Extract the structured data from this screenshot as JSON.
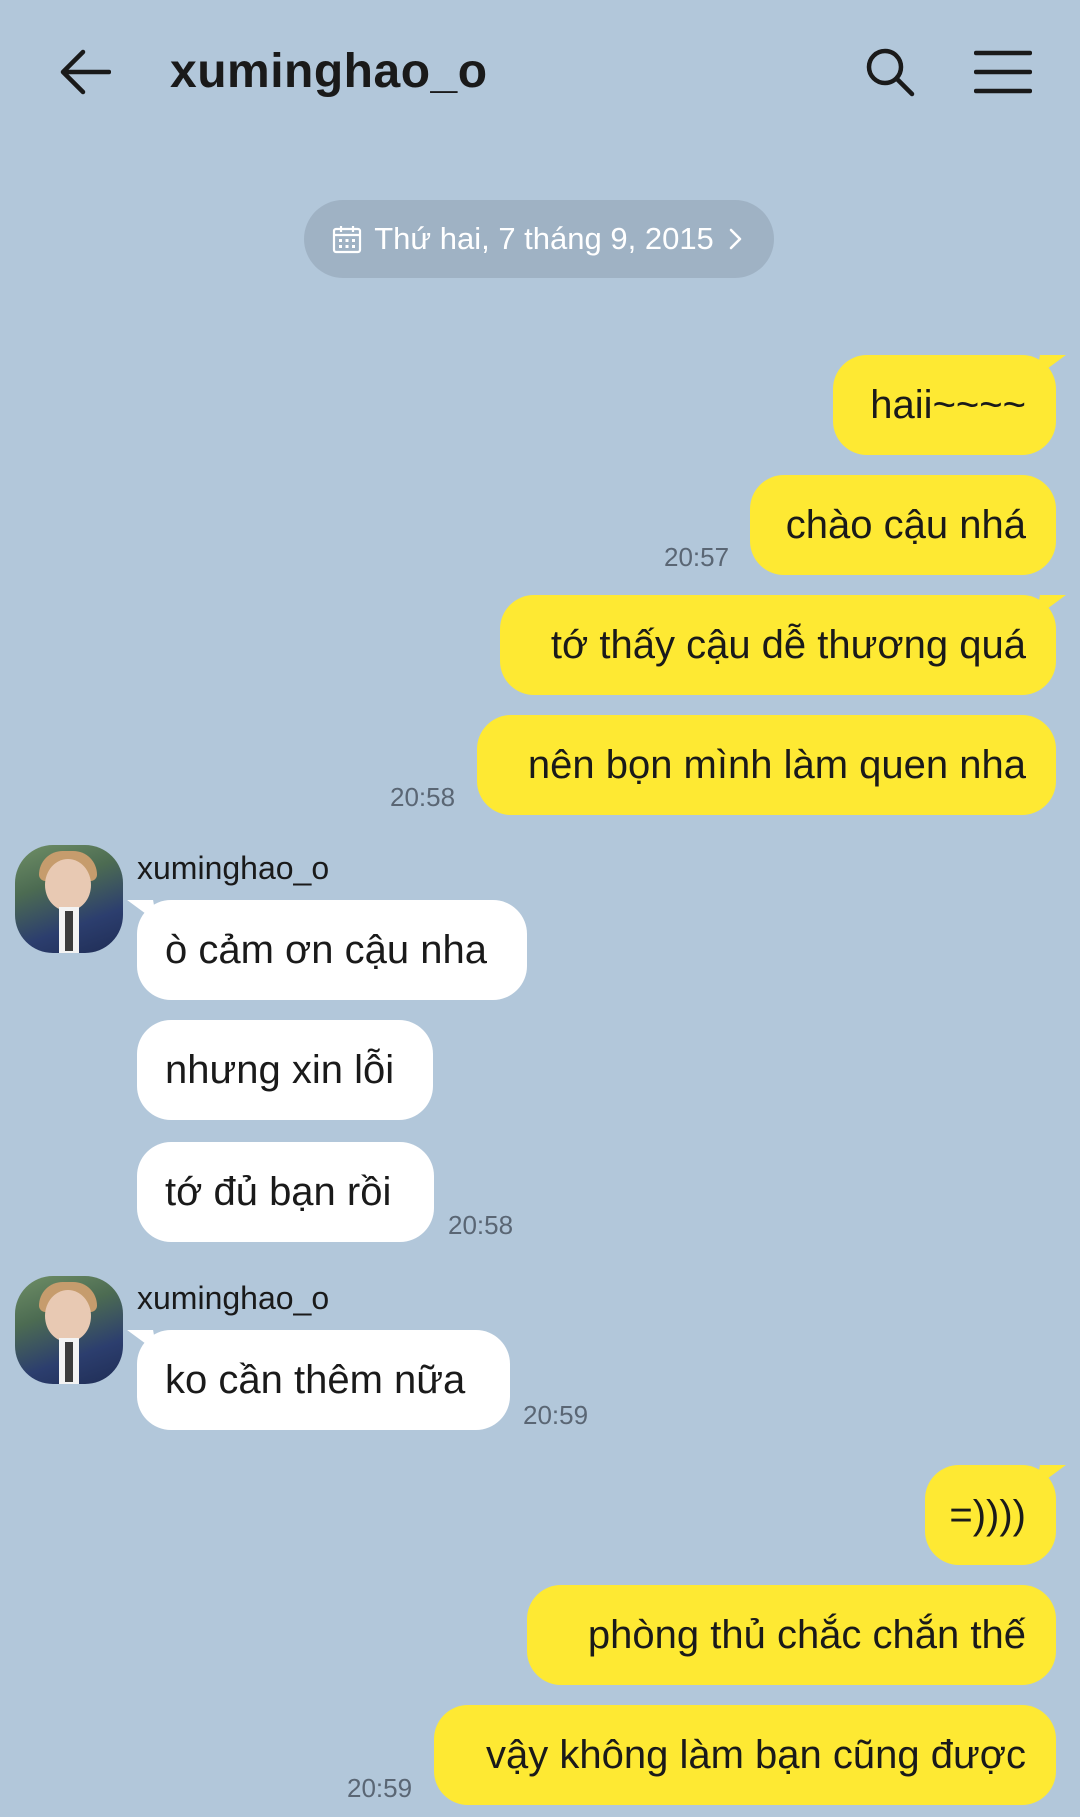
{
  "header": {
    "title": "xuminghao_o",
    "back_icon": "arrow-left-icon",
    "search_icon": "search-icon",
    "menu_icon": "hamburger-menu-icon"
  },
  "date_chip": {
    "label": "Thứ hai, 7 tháng 9, 2015",
    "icon": "calendar-icon"
  },
  "colors": {
    "background": "#b2c7da",
    "outgoing_bubble": "#fee933",
    "incoming_bubble": "#ffffff",
    "date_chip": "#9fb2c4"
  },
  "messages": [
    {
      "dir": "out",
      "text": "haii~~~~"
    },
    {
      "dir": "out",
      "text": "chào cậu nhá",
      "time": "20:57"
    },
    {
      "dir": "out",
      "text": "tớ thấy cậu dễ thương quá"
    },
    {
      "dir": "out",
      "text": "nên bọn mình làm quen nha",
      "time": "20:58"
    },
    {
      "dir": "in",
      "sender": "xuminghao_o",
      "text": "ò cảm ơn cậu nha"
    },
    {
      "dir": "in",
      "text": "nhưng xin lỗi"
    },
    {
      "dir": "in",
      "text": "tớ đủ bạn rồi",
      "time": "20:58"
    },
    {
      "dir": "in",
      "sender": "xuminghao_o",
      "text": "ko cần thêm nữa",
      "time": "20:59"
    },
    {
      "dir": "out",
      "text": "=))))"
    },
    {
      "dir": "out",
      "text": "phòng thủ chắc chắn thế"
    },
    {
      "dir": "out",
      "text": "vậy không làm bạn cũng được",
      "time": "20:59"
    }
  ]
}
